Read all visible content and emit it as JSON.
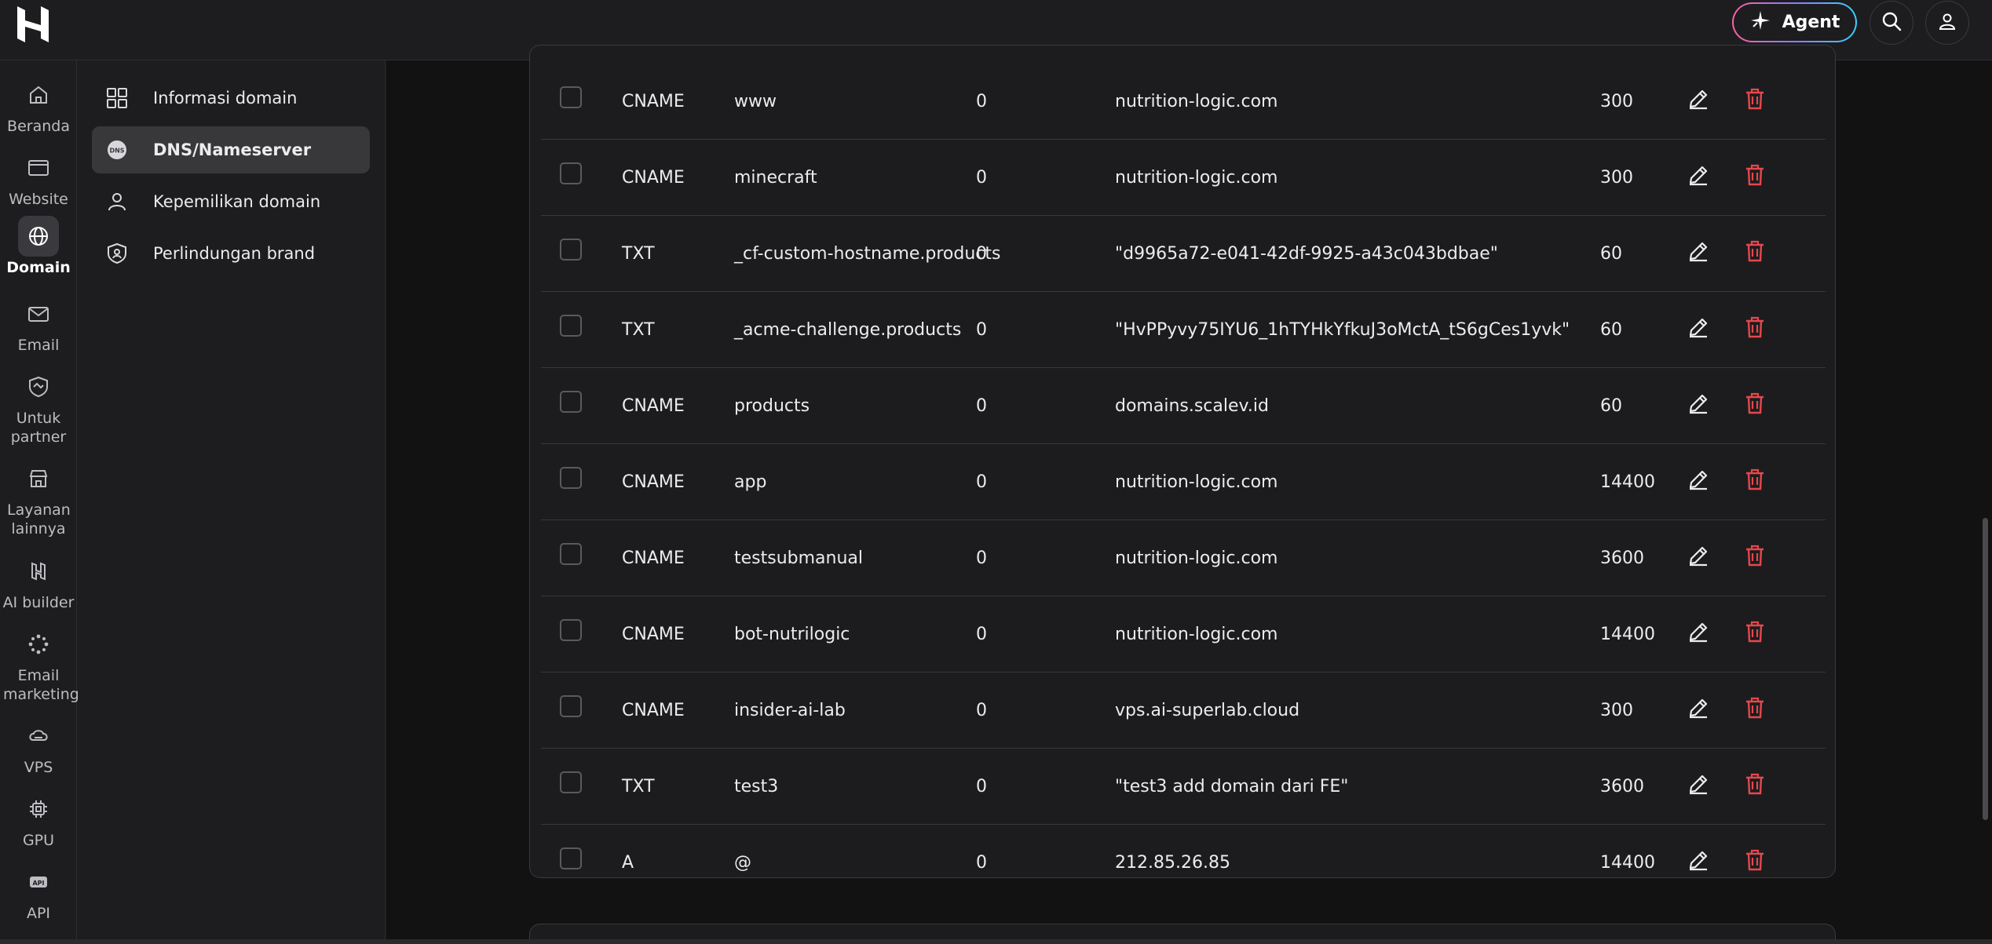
{
  "header": {
    "agent_label": "Agent"
  },
  "rail": {
    "items": [
      {
        "label": "Beranda",
        "icon": "home-icon"
      },
      {
        "label": "Website",
        "icon": "browser-icon"
      },
      {
        "label": "Domain",
        "icon": "globe-icon",
        "active": true
      },
      {
        "label": "Email",
        "icon": "mail-icon"
      },
      {
        "label": "Untuk partner",
        "icon": "handshake-shield-icon"
      },
      {
        "label": "Layanan lainnya",
        "icon": "store-icon"
      },
      {
        "label": "AI builder",
        "icon": "ai-builder-icon"
      },
      {
        "label": "Email marketing",
        "icon": "spark-icon"
      },
      {
        "label": "VPS",
        "icon": "cloud-server-icon"
      },
      {
        "label": "GPU",
        "icon": "chip-icon"
      },
      {
        "label": "API",
        "icon": "api-icon"
      }
    ]
  },
  "subnav": {
    "items": [
      {
        "label": "Informasi domain",
        "icon": "grid-icon"
      },
      {
        "label": "DNS/Nameserver",
        "icon": "dns-icon",
        "active": true
      },
      {
        "label": "Kepemilikan domain",
        "icon": "person-icon"
      },
      {
        "label": "Perlindungan brand",
        "icon": "shield-icon"
      }
    ]
  },
  "dns_records": [
    {
      "type": "CNAME",
      "name": "www",
      "priority": "0",
      "content": "nutrition-logic.com",
      "ttl": "300"
    },
    {
      "type": "CNAME",
      "name": "minecraft",
      "priority": "0",
      "content": "nutrition-logic.com",
      "ttl": "300"
    },
    {
      "type": "TXT",
      "name": "_cf-custom-hostname.products",
      "priority": "0",
      "content": "\"d9965a72-e041-42df-9925-a43c043bdbae\"",
      "ttl": "60"
    },
    {
      "type": "TXT",
      "name": "_acme-challenge.products",
      "priority": "0",
      "content": "\"HvPPyvy75IYU6_1hTYHkYfkuJ3oMctA_tS6gCes1yvk\"",
      "ttl": "60"
    },
    {
      "type": "CNAME",
      "name": "products",
      "priority": "0",
      "content": "domains.scalev.id",
      "ttl": "60"
    },
    {
      "type": "CNAME",
      "name": "app",
      "priority": "0",
      "content": "nutrition-logic.com",
      "ttl": "14400"
    },
    {
      "type": "CNAME",
      "name": "testsubmanual",
      "priority": "0",
      "content": "nutrition-logic.com",
      "ttl": "3600"
    },
    {
      "type": "CNAME",
      "name": "bot-nutrilogic",
      "priority": "0",
      "content": "nutrition-logic.com",
      "ttl": "14400"
    },
    {
      "type": "CNAME",
      "name": "insider-ai-lab",
      "priority": "0",
      "content": "vps.ai-superlab.cloud",
      "ttl": "300"
    },
    {
      "type": "TXT",
      "name": "test3",
      "priority": "0",
      "content": "\"test3 add domain dari FE\"",
      "ttl": "3600"
    },
    {
      "type": "A",
      "name": "@",
      "priority": "0",
      "content": "212.85.26.85",
      "ttl": "14400"
    }
  ],
  "colors": {
    "delete": "#e5484d",
    "accent_gradient": [
      "#ff5fa2",
      "#8c7cff",
      "#3ad1ff"
    ]
  }
}
